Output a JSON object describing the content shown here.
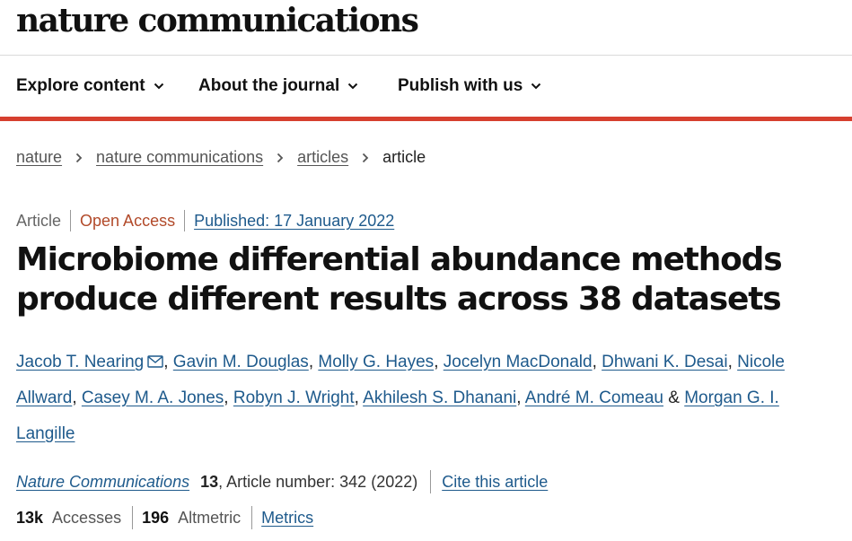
{
  "header": {
    "logo_text": "nature communications"
  },
  "nav": {
    "items": [
      {
        "label": "Explore content"
      },
      {
        "label": "About the journal"
      },
      {
        "label": "Publish with us"
      }
    ]
  },
  "breadcrumb": {
    "items": [
      "nature",
      "nature communications",
      "articles"
    ],
    "current": "article"
  },
  "article": {
    "type": "Article",
    "access": "Open Access",
    "published": "Published: 17 January 2022",
    "title": "Microbiome differential abundance methods produce different results across 38 datasets",
    "authors": [
      "Jacob T. Nearing",
      "Gavin M. Douglas",
      "Molly G. Hayes",
      "Jocelyn MacDonald",
      "Dhwani K. Desai",
      "Nicole Allward",
      "Casey M. A. Jones",
      "Robyn J. Wright",
      "Akhilesh S. Dhanani",
      "André M. Comeau",
      "Morgan G. I. Langille"
    ],
    "author_separator": ", ",
    "last_author_joiner": "&",
    "citation": {
      "journal": "Nature Communications",
      "volume": "13",
      "article_number": ", Article number: 342 (2022)",
      "cite_label": "Cite this article"
    },
    "metrics": {
      "accesses_value": "13k",
      "accesses_label": "Accesses",
      "altmetric_value": "196",
      "altmetric_label": "Altmetric",
      "metrics_link": "Metrics"
    }
  },
  "icons": {
    "chevron": "chevron-down-icon",
    "breadcrumb_separator": "chevron-right-icon",
    "mail": "envelope-icon"
  },
  "colors": {
    "accent_red": "#d63f2f",
    "link_blue": "#1e5a8c",
    "open_access": "#b24a2a"
  }
}
